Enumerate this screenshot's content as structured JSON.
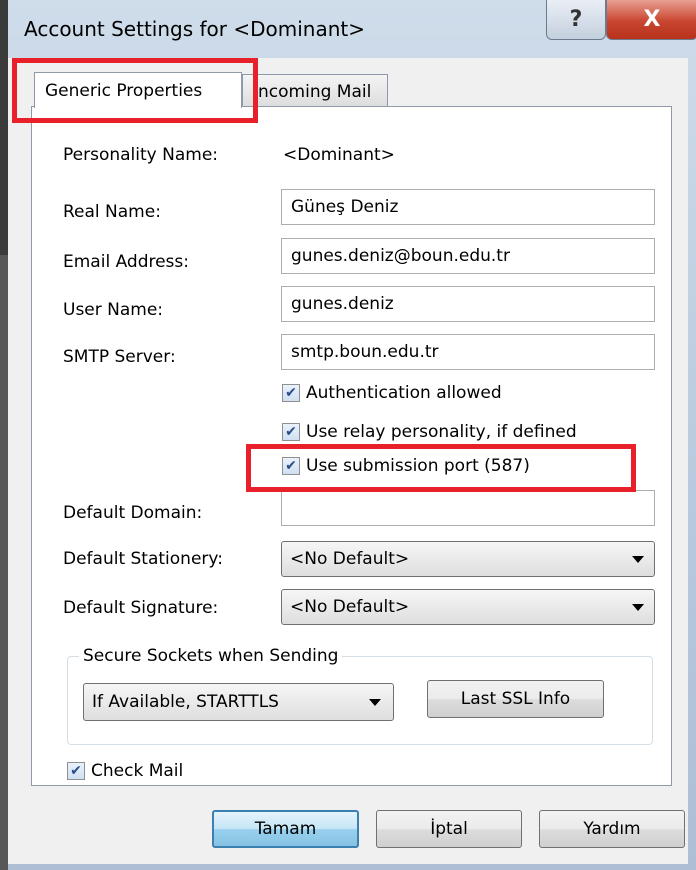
{
  "window": {
    "title": "Account Settings for <Dominant>",
    "help_glyph": "?",
    "close_glyph": "X"
  },
  "tabs": [
    {
      "label": "Generic Properties",
      "selected": true
    },
    {
      "label": "Incoming Mail",
      "selected": false
    }
  ],
  "form": {
    "personality_name": {
      "label": "Personality Name:",
      "value": "<Dominant>"
    },
    "real_name": {
      "label": "Real Name:",
      "value": "Güneş Deniz"
    },
    "email_address": {
      "label": "Email Address:",
      "value": "gunes.deniz@boun.edu.tr"
    },
    "user_name": {
      "label": "User Name:",
      "value": "gunes.deniz"
    },
    "smtp_server": {
      "label": "SMTP Server:",
      "value": "smtp.boun.edu.tr"
    },
    "checkboxes": [
      {
        "label": "Authentication allowed",
        "checked": true
      },
      {
        "label": "Use relay personality, if defined",
        "checked": true
      },
      {
        "label": "Use submission port (587)",
        "checked": true
      }
    ],
    "default_domain": {
      "label": "Default Domain:",
      "value": ""
    },
    "default_stationery": {
      "label": "Default Stationery:",
      "value": "<No Default>"
    },
    "default_signature": {
      "label": "Default Signature:",
      "value": "<No Default>"
    }
  },
  "secure_sockets": {
    "legend": "Secure Sockets when Sending",
    "value": "If Available, STARTTLS",
    "ssl_button": "Last SSL Info"
  },
  "check_mail": {
    "label": "Check Mail",
    "checked": true
  },
  "buttons": {
    "ok": "Tamam",
    "cancel": "İptal",
    "help": "Yardım"
  },
  "check_glyph": "✔",
  "highlight_color": "#e8202a"
}
